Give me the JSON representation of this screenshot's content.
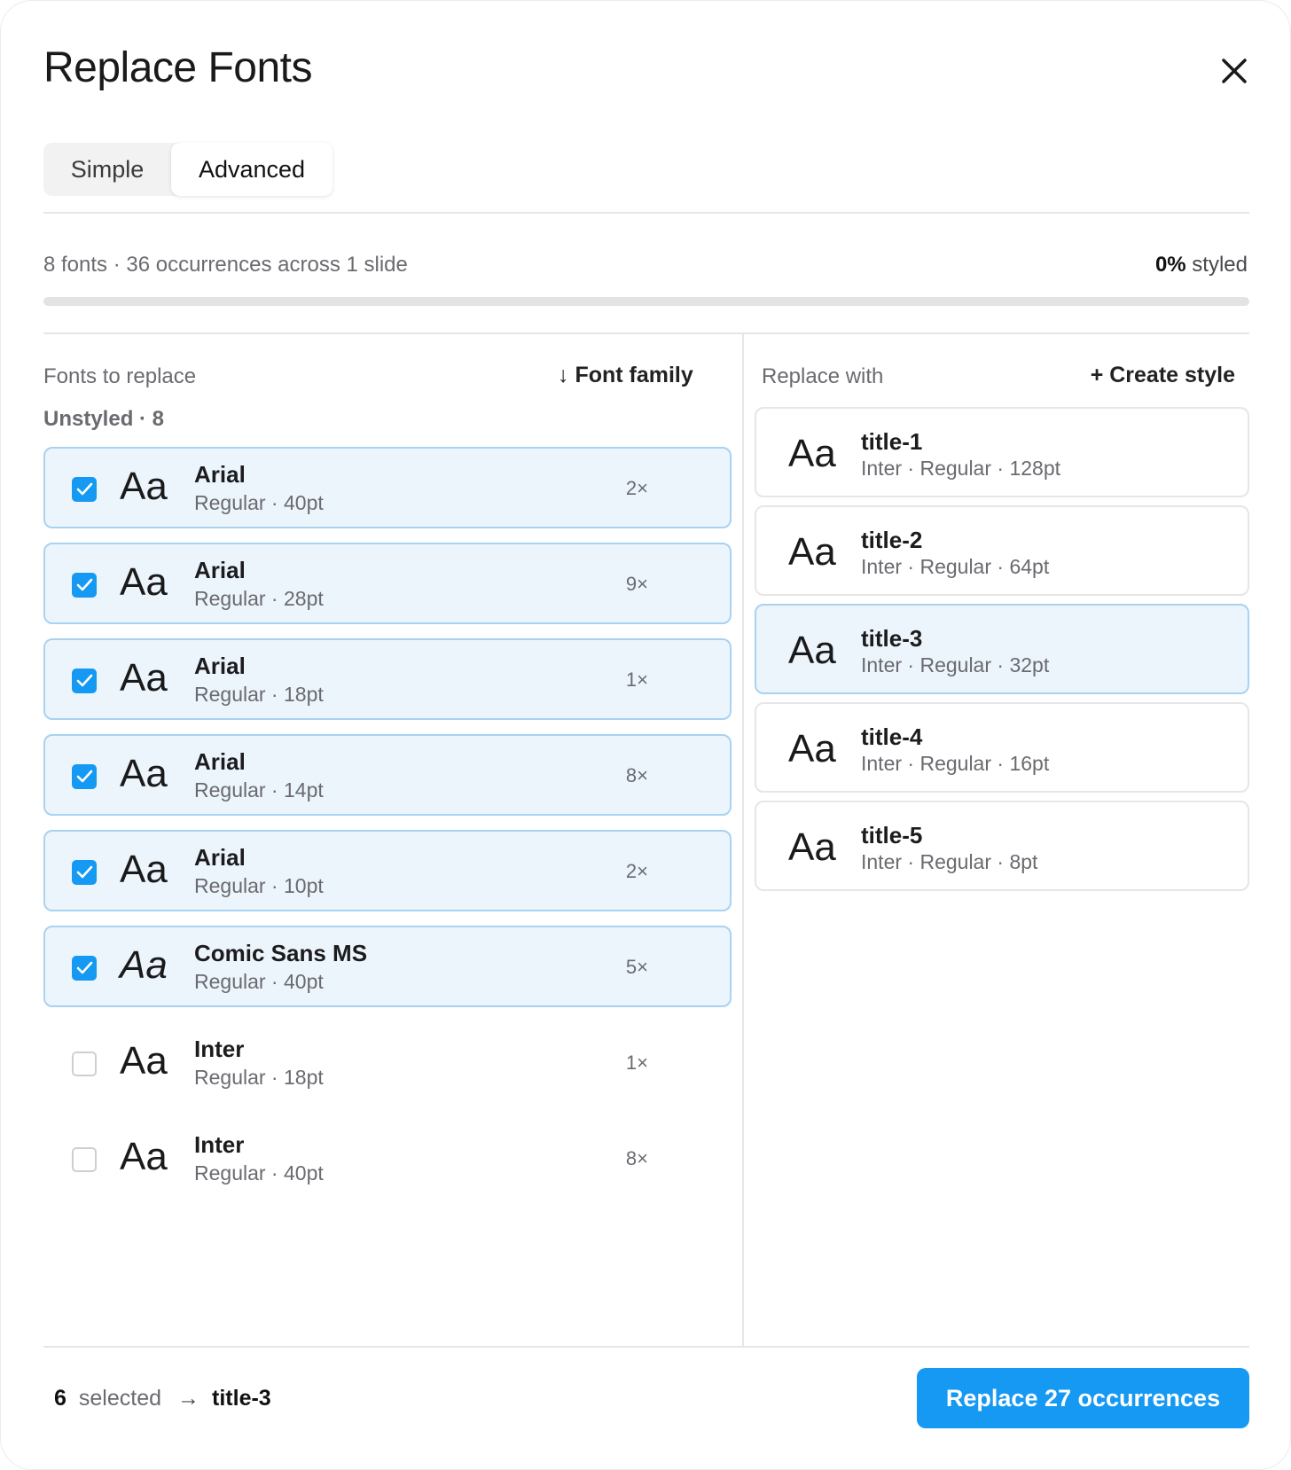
{
  "dialog": {
    "title": "Replace Fonts",
    "close_icon": "close-icon"
  },
  "tabs": [
    {
      "label": "Simple",
      "active": false
    },
    {
      "label": "Advanced",
      "active": true
    }
  ],
  "stats": {
    "summary": "8 fonts · 36 occurrences across 1 slide",
    "styled_percent": "0%",
    "styled_label": "styled",
    "progress_fraction": 0
  },
  "left_column": {
    "header": "Fonts to replace",
    "sort_label": "↓ Font family",
    "group_label": "Unstyled · 8",
    "fonts": [
      {
        "preview": "Aa",
        "name": "Arial",
        "detail": "Regular · 40pt",
        "count": "2×",
        "checked": true
      },
      {
        "preview": "Aa",
        "name": "Arial",
        "detail": "Regular · 28pt",
        "count": "9×",
        "checked": true
      },
      {
        "preview": "Aa",
        "name": "Arial",
        "detail": "Regular · 18pt",
        "count": "1×",
        "checked": true
      },
      {
        "preview": "Aa",
        "name": "Arial",
        "detail": "Regular · 14pt",
        "count": "8×",
        "checked": true
      },
      {
        "preview": "Aa",
        "name": "Arial",
        "detail": "Regular · 10pt",
        "count": "2×",
        "checked": true
      },
      {
        "preview": "Aa",
        "name": "Comic Sans MS",
        "detail": "Regular · 40pt",
        "count": "5×",
        "checked": true
      },
      {
        "preview": "Aa",
        "name": "Inter",
        "detail": "Regular · 18pt",
        "count": "1×",
        "checked": false
      },
      {
        "preview": "Aa",
        "name": "Inter",
        "detail": "Regular · 40pt",
        "count": "8×",
        "checked": false
      }
    ]
  },
  "right_column": {
    "header": "Replace with",
    "create_label": "+ Create style",
    "styles": [
      {
        "preview": "Aa",
        "name": "title-1",
        "detail": "Inter · Regular · 128pt",
        "selected": false
      },
      {
        "preview": "Aa",
        "name": "title-2",
        "detail": "Inter · Regular · 64pt",
        "selected": false
      },
      {
        "preview": "Aa",
        "name": "title-3",
        "detail": "Inter · Regular · 32pt",
        "selected": true
      },
      {
        "preview": "Aa",
        "name": "title-4",
        "detail": "Inter · Regular · 16pt",
        "selected": false
      },
      {
        "preview": "Aa",
        "name": "title-5",
        "detail": "Inter · Regular · 8pt",
        "selected": false
      }
    ]
  },
  "footer": {
    "selected_count": "6",
    "selected_label": "selected",
    "arrow": "→",
    "target": "title-3",
    "primary_label": "Replace 27 occurrences"
  },
  "colors": {
    "accent": "#1599f2",
    "selected_bg": "#edf5fc",
    "selected_border": "#a8d2f2"
  }
}
